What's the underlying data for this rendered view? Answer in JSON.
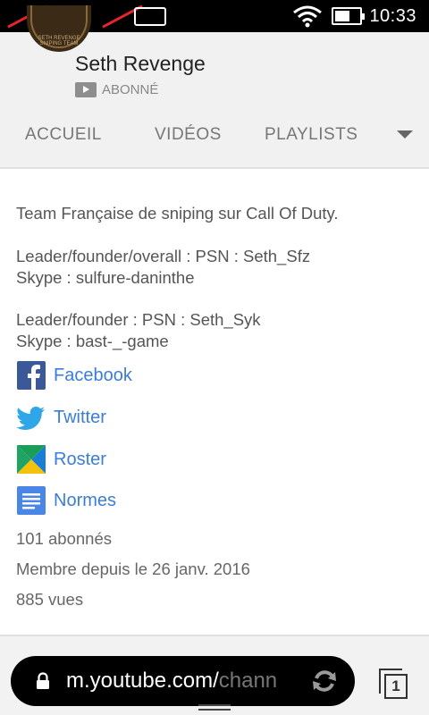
{
  "status_bar": {
    "sim1_badge": "1",
    "time": "10:33",
    "battery_level": 0.6
  },
  "channel": {
    "avatar_text": "SETH REVENGE SNIPING TEAM",
    "name": "Seth Revenge",
    "subscribed_label": "ABONNÉ"
  },
  "tabs": [
    "ACCUEIL",
    "VIDÉOS",
    "PLAYLISTS"
  ],
  "about": {
    "description": "Team Française de sniping sur Call Of Duty.",
    "leader1_line1": "Leader/founder/overall : PSN : Seth_Sfz",
    "leader1_line2": "Skype : sulfure-daninthe",
    "leader2_line1": "Leader/founder : PSN : Seth_Syk",
    "leader2_line2": "Skype : bast-_-game",
    "links": [
      {
        "label": "Facebook",
        "icon": "facebook-icon",
        "color": "#3b5998"
      },
      {
        "label": "Twitter",
        "icon": "twitter-icon",
        "color": "#2fa6e8"
      },
      {
        "label": "Roster",
        "icon": "roster-icon",
        "color": "#1fa463"
      },
      {
        "label": "Normes",
        "icon": "docs-icon",
        "color": "#4a86e8"
      }
    ],
    "subscribers": "101 abonnés",
    "member_since": "Membre depuis le 26 janv. 2016",
    "views": "885 vues"
  },
  "browser": {
    "url_main": "m.youtube.com/",
    "url_faded": "chann",
    "tab_count": "1"
  },
  "colors": {
    "link": "#3b7dd8",
    "sim_badge": "#33b5e5",
    "sim_slash": "#e3262b"
  }
}
